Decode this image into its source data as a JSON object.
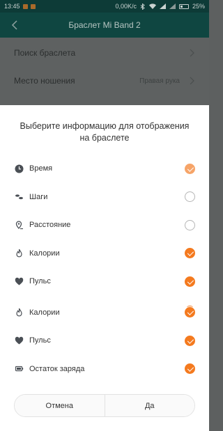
{
  "status_bar": {
    "time": "13:45",
    "speed": "0,00K/c",
    "battery": "25%"
  },
  "app_bar": {
    "title": "Браслет Mi Band 2"
  },
  "background_settings": [
    {
      "label": "Поиск браслета",
      "value": ""
    },
    {
      "label": "Место ношения",
      "value": "Правая рука"
    }
  ],
  "dialog": {
    "title": "Выберите информацию для отображения на браслете",
    "options": [
      {
        "label": "Время",
        "icon": "clock-icon",
        "checked": true
      },
      {
        "label": "Шаги",
        "icon": "steps-icon",
        "checked": false
      },
      {
        "label": "Расстояние",
        "icon": "location-pin-icon",
        "checked": false
      },
      {
        "label": "Калории",
        "icon": "flame-icon",
        "checked": true
      },
      {
        "label": "Пульс",
        "icon": "heart-icon",
        "checked": true
      },
      {
        "label": "Калории",
        "icon": "flame-icon",
        "checked": true
      },
      {
        "label": "Пульс",
        "icon": "heart-icon",
        "checked": true
      },
      {
        "label": "Остаток заряда",
        "icon": "battery-icon",
        "checked": true
      }
    ],
    "cancel_label": "Отмена",
    "ok_label": "Да"
  },
  "colors": {
    "accent": "#f47a1f",
    "app_bar": "#0f4641",
    "overlay": "#5e6161"
  }
}
